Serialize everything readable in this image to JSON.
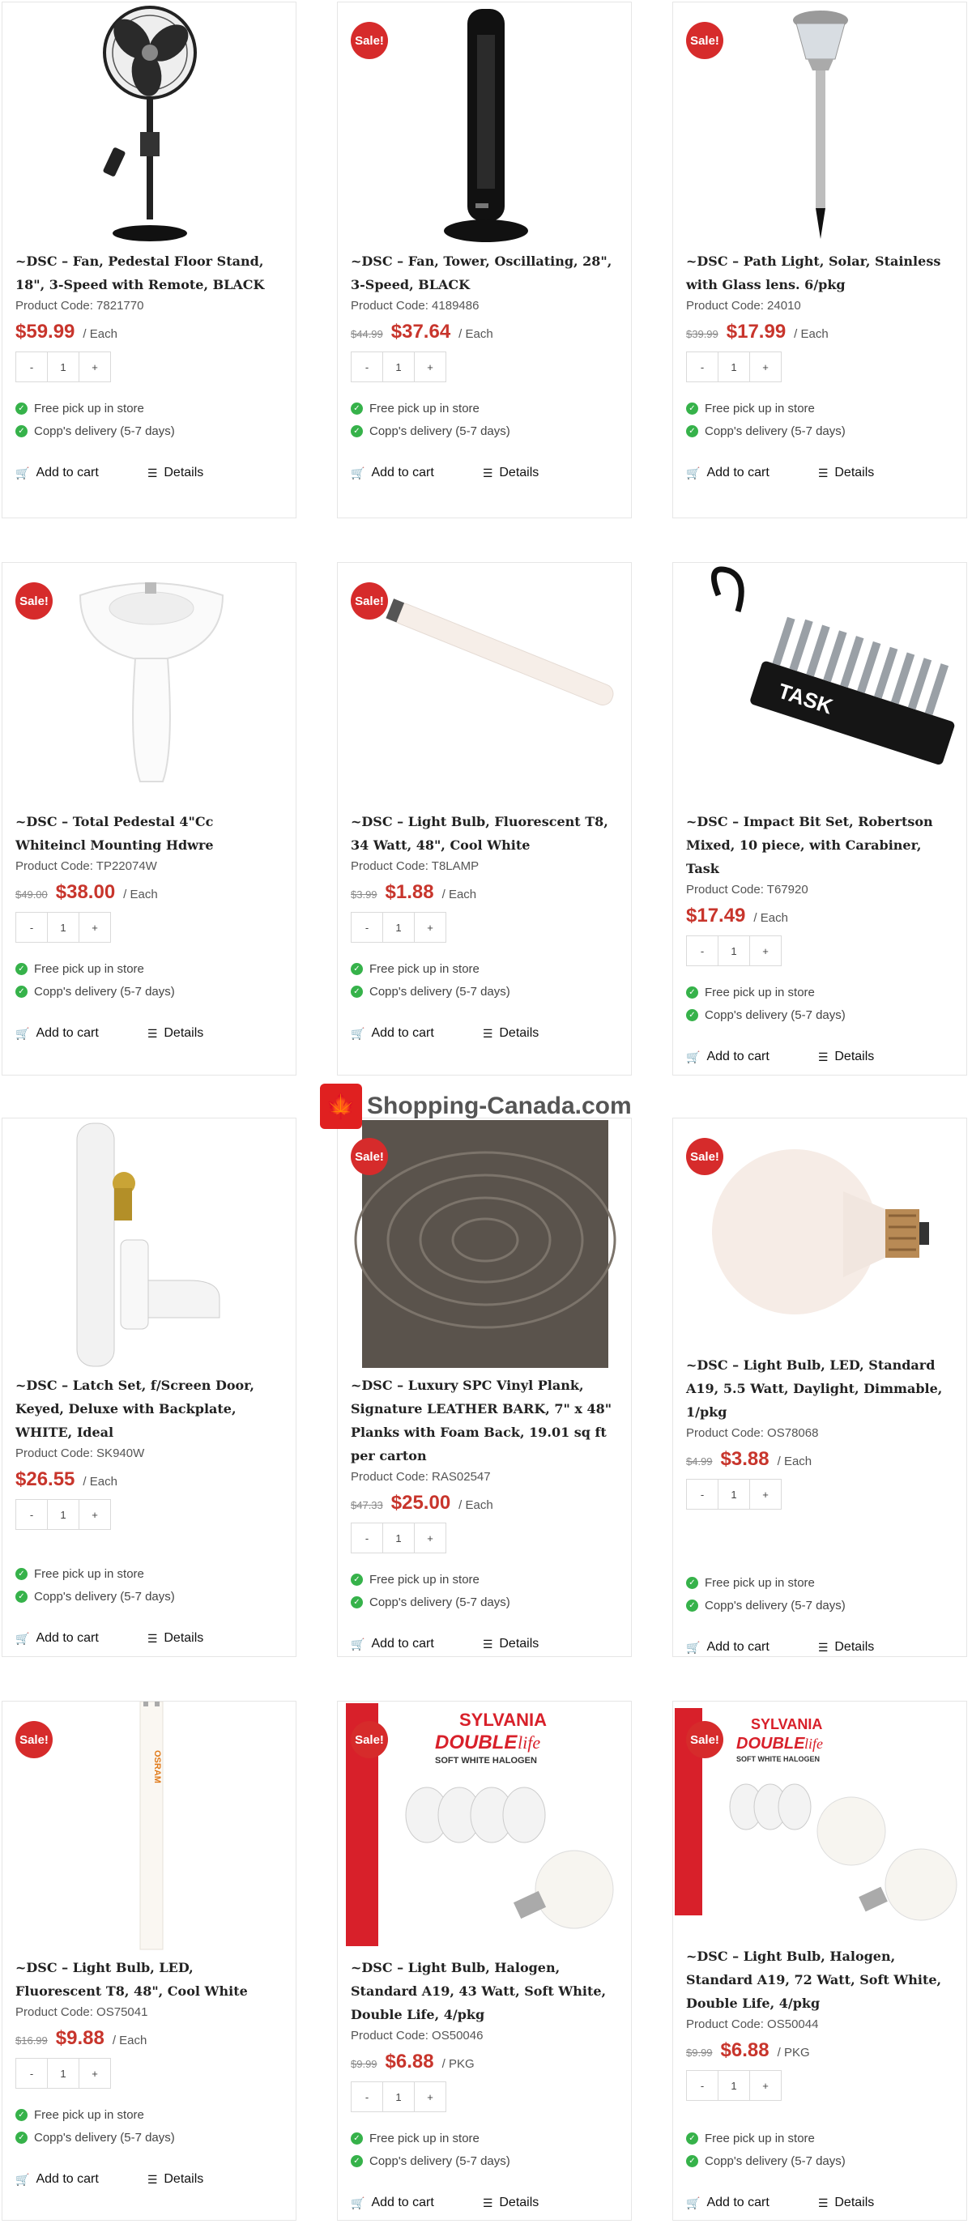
{
  "products": [
    {
      "title": "~DSC – Fan, Pedestal Floor Stand, 18\", 3-Speed with Remote, BLACK",
      "code": "Product Code: 7821770",
      "old": "",
      "price": "$59.99",
      "unit": "/ Each",
      "sale": false,
      "image": "pedestal-fan"
    },
    {
      "title": "~DSC – Fan, Tower, Oscillating, 28\", 3-Speed, BLACK",
      "code": "Product Code: 4189486",
      "old": "$44.99",
      "price": "$37.64",
      "unit": "/ Each",
      "sale": true,
      "image": "tower-fan"
    },
    {
      "title": "~DSC – Path Light, Solar, Stainless with Glass lens. 6/pkg",
      "code": "Product Code: 24010",
      "old": "$39.99",
      "price": "$17.99",
      "unit": "/ Each",
      "sale": true,
      "image": "path-light"
    },
    {
      "title": "~DSC – Total Pedestal 4\"Cc Whiteincl Mounting Hdwre",
      "code": "Product Code: TP22074W",
      "old": "$49.00",
      "price": "$38.00",
      "unit": "/ Each",
      "sale": true,
      "image": "pedestal-sink"
    },
    {
      "title": "~DSC – Light Bulb, Fluorescent T8, 34 Watt, 48\", Cool White",
      "code": "Product Code: T8LAMP",
      "old": "$3.99",
      "price": "$1.88",
      "unit": "/ Each",
      "sale": true,
      "image": "fluorescent-tube"
    },
    {
      "title": "~DSC – Impact Bit Set, Robertson Mixed, 10 piece, with Carabiner, Task",
      "code": "Product Code: T67920",
      "old": "",
      "price": "$17.49",
      "unit": "/ Each",
      "sale": false,
      "image": "bit-set"
    },
    {
      "title": "~DSC – Latch Set, f/Screen Door, Keyed, Deluxe with Backplate, WHITE, Ideal",
      "code": "Product Code: SK940W",
      "old": "",
      "price": "$26.55",
      "unit": "/ Each",
      "sale": false,
      "image": "latch-set"
    },
    {
      "title": "~DSC – Luxury SPC Vinyl Plank, Signature LEATHER BARK, 7\" x 48\" Planks with Foam Back, 19.01 sq ft per carton",
      "code": "Product Code: RAS02547",
      "old": "$47.33",
      "price": "$25.00",
      "unit": "/ Each",
      "sale": true,
      "image": "vinyl-plank"
    },
    {
      "title": "~DSC – Light Bulb, LED, Standard A19, 5.5 Watt, Daylight, Dimmable, 1/pkg",
      "code": "Product Code: OS78068",
      "old": "$4.99",
      "price": "$3.88",
      "unit": "/ Each",
      "sale": true,
      "image": "led-bulb"
    },
    {
      "title": "~DSC – Light Bulb, LED, Fluorescent T8, 48\", Cool White",
      "code": "Product Code: OS75041",
      "old": "$16.99",
      "price": "$9.88",
      "unit": "/ Each",
      "sale": true,
      "image": "led-tube"
    },
    {
      "title": "~DSC – Light Bulb, Halogen, Standard A19, 43 Watt, Soft White, Double Life, 4/pkg",
      "code": "Product Code: OS50046",
      "old": "$9.99",
      "price": "$6.88",
      "unit": "/ PKG",
      "sale": true,
      "image": "halogen-box-43"
    },
    {
      "title": "~DSC – Light Bulb, Halogen, Standard A19, 72 Watt, Soft White, Double Life, 4/pkg",
      "code": "Product Code: OS50044",
      "old": "$9.99",
      "price": "$6.88",
      "unit": "/ PKG",
      "sale": true,
      "image": "halogen-box-72"
    }
  ],
  "labels": {
    "sale": "Sale!",
    "qty_minus": "-",
    "qty_value": "1",
    "qty_plus": "+",
    "pickup": "Free pick up in store",
    "delivery": "Copp's delivery (5-7 days)",
    "add_to_cart": "Add to cart",
    "details": "Details",
    "box_brand": "SYLVANIA",
    "box_line": "DOUBLE",
    "box_life": "life",
    "box_sub": "SOFT WHITE HALOGEN",
    "tube_brand": "OSRAM",
    "task_brand": "TASK"
  },
  "watermark": {
    "text": "Shopping-Canada.com"
  },
  "colors": {
    "price": "#c8352c",
    "sale_badge": "#d62b2b",
    "check": "#36b24a",
    "sylvania_red": "#d8202a"
  }
}
